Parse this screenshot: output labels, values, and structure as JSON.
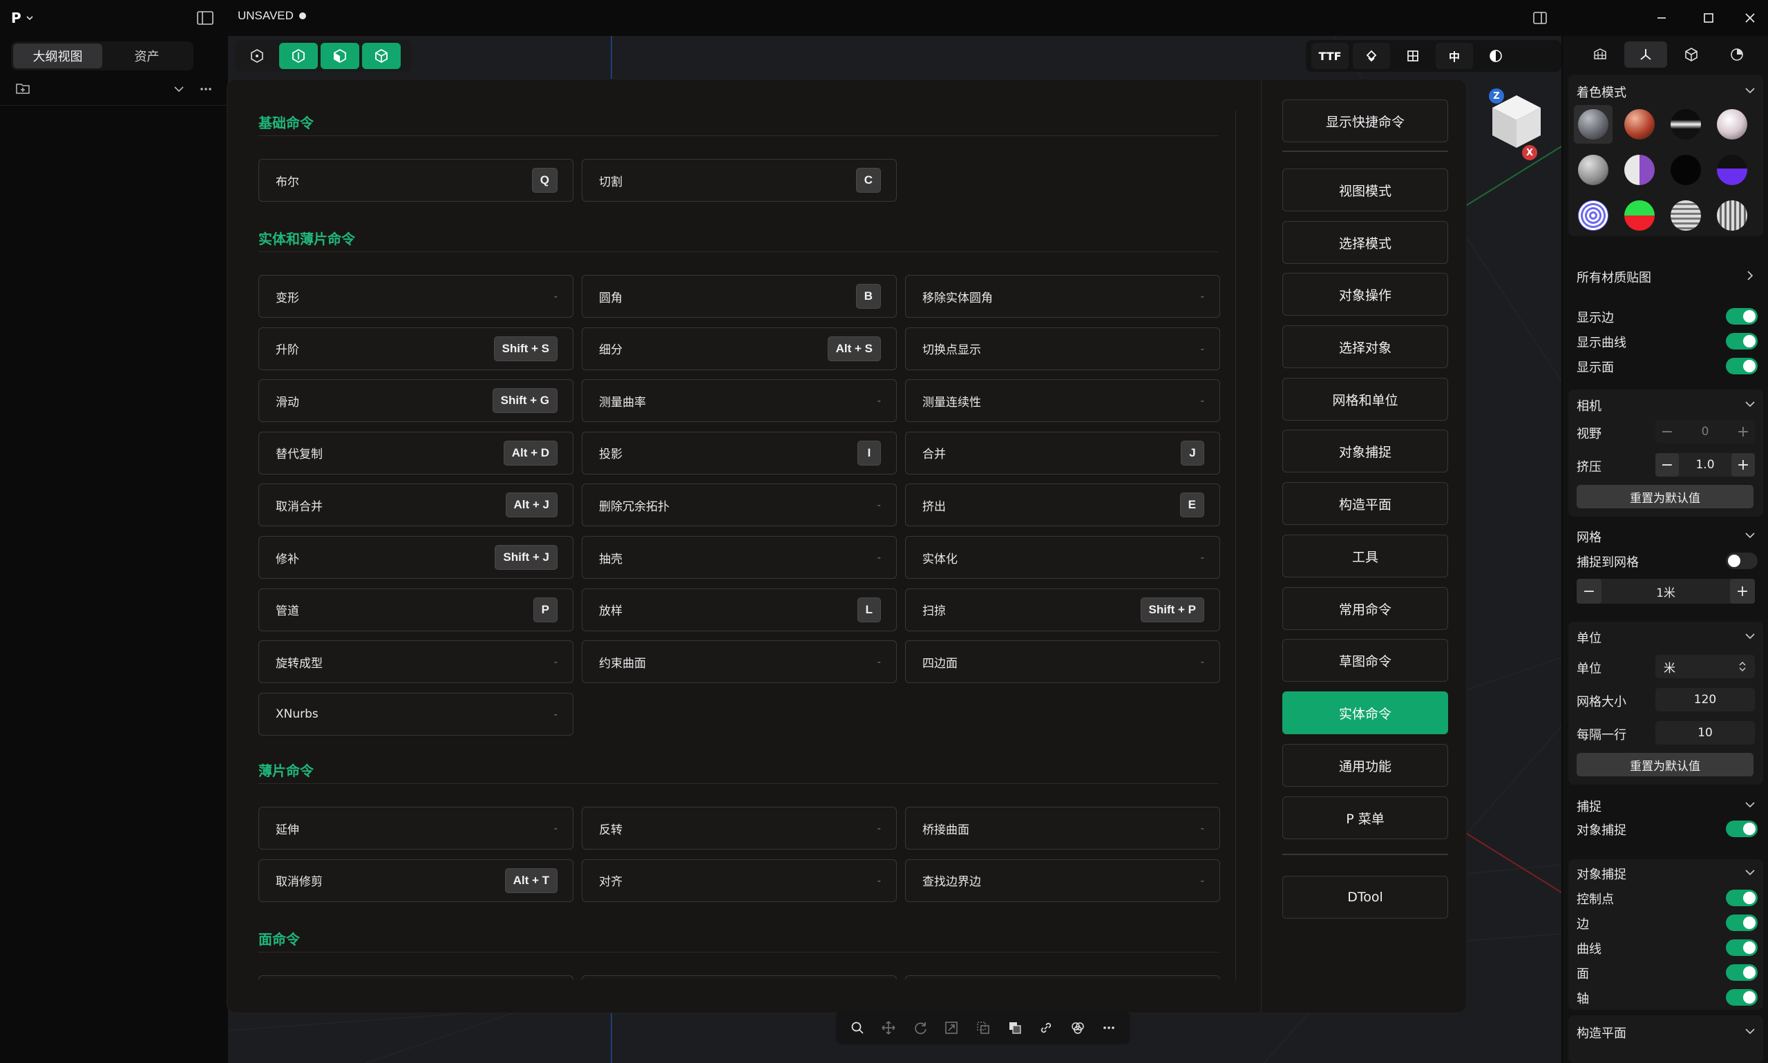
{
  "titlebar": {
    "app_letter": "P",
    "doc_title": "UNSAVED"
  },
  "left_tabs": {
    "outline": "大纲视图",
    "assets": "资产"
  },
  "toolbar_right": {
    "ttf": "TTF",
    "zhong": "中"
  },
  "modal": {
    "sections": [
      {
        "title": "基础命令"
      },
      {
        "title": "实体和薄片命令"
      },
      {
        "title": "薄片命令"
      },
      {
        "title": "面命令"
      }
    ],
    "basic": [
      {
        "name": "布尔",
        "key": "Q"
      },
      {
        "name": "切割",
        "key": "C"
      }
    ],
    "solid": [
      {
        "name": "变形",
        "key": "-"
      },
      {
        "name": "圆角",
        "key": "B"
      },
      {
        "name": "移除实体圆角",
        "key": "-"
      },
      {
        "name": "升阶",
        "key": "Shift + S"
      },
      {
        "name": "细分",
        "key": "Alt + S"
      },
      {
        "name": "切换点显示",
        "key": "-"
      },
      {
        "name": "滑动",
        "key": "Shift + G"
      },
      {
        "name": "测量曲率",
        "key": "-"
      },
      {
        "name": "测量连续性",
        "key": "-"
      },
      {
        "name": "替代复制",
        "key": "Alt + D"
      },
      {
        "name": "投影",
        "key": "I"
      },
      {
        "name": "合并",
        "key": "J"
      },
      {
        "name": "取消合并",
        "key": "Alt + J"
      },
      {
        "name": "删除冗余拓扑",
        "key": "-"
      },
      {
        "name": "挤出",
        "key": "E"
      },
      {
        "name": "修补",
        "key": "Shift + J"
      },
      {
        "name": "抽壳",
        "key": "-"
      },
      {
        "name": "实体化",
        "key": "-"
      },
      {
        "name": "管道",
        "key": "P"
      },
      {
        "name": "放样",
        "key": "L"
      },
      {
        "name": "扫掠",
        "key": "Shift + P"
      },
      {
        "name": "旋转成型",
        "key": "-"
      },
      {
        "name": "约束曲面",
        "key": "-"
      },
      {
        "name": "四边面",
        "key": "-"
      },
      {
        "name": "XNurbs",
        "key": "-"
      }
    ],
    "sheet": [
      {
        "name": "延伸",
        "key": "-"
      },
      {
        "name": "反转",
        "key": "-"
      },
      {
        "name": "桥接曲面",
        "key": "-"
      },
      {
        "name": "取消修剪",
        "key": "Alt + T"
      },
      {
        "name": "对齐",
        "key": "-"
      },
      {
        "name": "查找边界边",
        "key": "-"
      }
    ],
    "nav": [
      {
        "label": "显示快捷命令"
      },
      {
        "label": "视图模式"
      },
      {
        "label": "选择模式"
      },
      {
        "label": "对象操作"
      },
      {
        "label": "选择对象"
      },
      {
        "label": "网格和单位"
      },
      {
        "label": "对象捕捉"
      },
      {
        "label": "构造平面"
      },
      {
        "label": "工具"
      },
      {
        "label": "常用命令"
      },
      {
        "label": "草图命令"
      },
      {
        "label": "实体命令",
        "active": true
      },
      {
        "label": "通用功能"
      },
      {
        "label": "P 菜单"
      },
      {
        "label": "DTool"
      }
    ]
  },
  "right_panel": {
    "shading": {
      "title": "着色模式"
    },
    "all_materials": "所有材质贴图",
    "display": [
      {
        "label": "显示边",
        "on": true
      },
      {
        "label": "显示曲线",
        "on": true
      },
      {
        "label": "显示面",
        "on": true
      }
    ],
    "camera": {
      "title": "相机",
      "fov_label": "视野",
      "fov_value": "0",
      "squeeze_label": "挤压",
      "squeeze_value": "1.0",
      "reset": "重置为默认值"
    },
    "grid": {
      "title": "网格",
      "snap_label": "捕捉到网格",
      "snap_on": false,
      "size_value": "1米"
    },
    "units": {
      "title": "单位",
      "unit_label": "单位",
      "unit_value": "米",
      "grid_size_label": "网格大小",
      "grid_size_value": "120",
      "every_row_label": "每隔一行",
      "every_row_value": "10",
      "reset": "重置为默认值"
    },
    "snap": {
      "title": "捕捉",
      "object_snap_label": "对象捕捉",
      "on": true
    },
    "object_snap": {
      "title": "对象捕捉",
      "items": [
        {
          "label": "控制点",
          "on": true
        },
        {
          "label": "边",
          "on": true
        },
        {
          "label": "曲线",
          "on": true
        },
        {
          "label": "面",
          "on": true
        },
        {
          "label": "轴",
          "on": true
        }
      ]
    },
    "cplane": {
      "title": "构造平面"
    }
  },
  "gizmo": {
    "z": "Z",
    "x": "X"
  },
  "colors": {
    "accent": "#11a66b",
    "section_title": "#1eb77a"
  }
}
